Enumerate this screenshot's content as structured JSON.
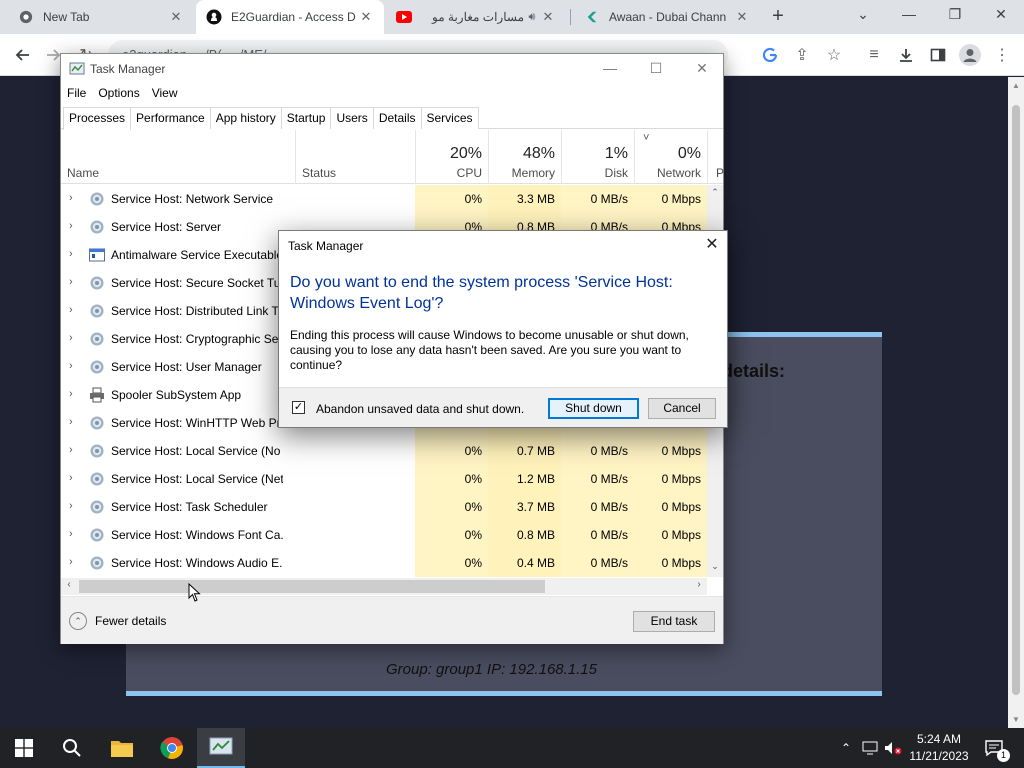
{
  "browser": {
    "tabs": [
      {
        "title": "New Tab",
        "icon": "chrome-icon"
      },
      {
        "title": "E2Guardian - Access D",
        "icon": "github-icon"
      },
      {
        "title": "مسارات مغاربة مو",
        "icon": "youtube-icon"
      },
      {
        "title": "Awaan - Dubai Chann",
        "icon": "awaan-icon"
      }
    ],
    "address": "e2guardian ... /B( ...  /ME/..."
  },
  "page": {
    "details_heading": "details:",
    "group_line": "Group: group1   IP: 192.168.1.15"
  },
  "taskmanager": {
    "title": "Task Manager",
    "menu": [
      "File",
      "Options",
      "View"
    ],
    "tabs": [
      "Processes",
      "Performance",
      "App history",
      "Startup",
      "Users",
      "Details",
      "Services"
    ],
    "columns": {
      "name": "Name",
      "status": "Status",
      "cpu": {
        "pct": "20%",
        "label": "CPU"
      },
      "memory": {
        "pct": "48%",
        "label": "Memory"
      },
      "disk": {
        "pct": "1%",
        "label": "Disk"
      },
      "network": {
        "pct": "0%",
        "label": "Network"
      },
      "power": "P"
    },
    "rows": [
      {
        "name": "Service Host: Network Service",
        "cpu": "0%",
        "mem": "3.3 MB",
        "disk": "0 MB/s",
        "net": "0 Mbps",
        "icon": "gear-icon"
      },
      {
        "name": "Service Host: Server",
        "cpu": "0%",
        "mem": "0.8 MB",
        "disk": "0 MB/s",
        "net": "0 Mbps",
        "icon": "gear-icon"
      },
      {
        "name": "Antimalware Service Executable",
        "cpu": "",
        "mem": "",
        "disk": "",
        "net": "",
        "icon": "window-icon"
      },
      {
        "name": "Service Host: Secure Socket Tun",
        "cpu": "",
        "mem": "",
        "disk": "",
        "net": "",
        "icon": "gear-icon"
      },
      {
        "name": "Service Host: Distributed Link Tr",
        "cpu": "",
        "mem": "",
        "disk": "",
        "net": "",
        "icon": "gear-icon"
      },
      {
        "name": "Service Host: Cryptographic Ser",
        "cpu": "",
        "mem": "",
        "disk": "",
        "net": "",
        "icon": "gear-icon"
      },
      {
        "name": "Service Host: User Manager",
        "cpu": "",
        "mem": "",
        "disk": "",
        "net": "",
        "icon": "gear-icon"
      },
      {
        "name": "Spooler SubSystem App",
        "cpu": "",
        "mem": "",
        "disk": "",
        "net": "",
        "icon": "printer-icon"
      },
      {
        "name": "Service Host: WinHTTP Web Pro",
        "cpu": "",
        "mem": "",
        "disk": "",
        "net": "",
        "icon": "gear-icon"
      },
      {
        "name": "Service Host: Local Service (No ...",
        "cpu": "0%",
        "mem": "0.7 MB",
        "disk": "0 MB/s",
        "net": "0 Mbps",
        "icon": "gear-icon"
      },
      {
        "name": "Service Host: Local Service (Net...",
        "cpu": "0%",
        "mem": "1.2 MB",
        "disk": "0 MB/s",
        "net": "0 Mbps",
        "icon": "gear-icon"
      },
      {
        "name": "Service Host: Task Scheduler",
        "cpu": "0%",
        "mem": "3.7 MB",
        "disk": "0 MB/s",
        "net": "0 Mbps",
        "icon": "gear-icon"
      },
      {
        "name": "Service Host: Windows Font Ca...",
        "cpu": "0%",
        "mem": "0.8 MB",
        "disk": "0 MB/s",
        "net": "0 Mbps",
        "icon": "gear-icon"
      },
      {
        "name": "Service Host: Windows Audio E...",
        "cpu": "0%",
        "mem": "0.4 MB",
        "disk": "0 MB/s",
        "net": "0 Mbps",
        "icon": "gear-icon"
      }
    ],
    "fewer_details": "Fewer details",
    "end_task": "End task"
  },
  "dialog": {
    "title": "Task Manager",
    "main": "Do you want to end the system process 'Service Host: Windows Event Log'?",
    "body": "Ending this process will cause Windows to become unusable or shut down, causing you to lose any data hasn't been saved. Are you sure you want to continue?",
    "checkbox_label": "Abandon unsaved data and shut down.",
    "checkbox_checked": true,
    "shutdown": "Shut down",
    "cancel": "Cancel"
  },
  "taskbar": {
    "time": "5:24 AM",
    "date": "11/21/2023",
    "notification_count": "1"
  },
  "colors": {
    "heat": "#fff4c4",
    "accent": "#0078d7",
    "dialog_main": "#003399",
    "card_border": "#8ec5f0"
  }
}
